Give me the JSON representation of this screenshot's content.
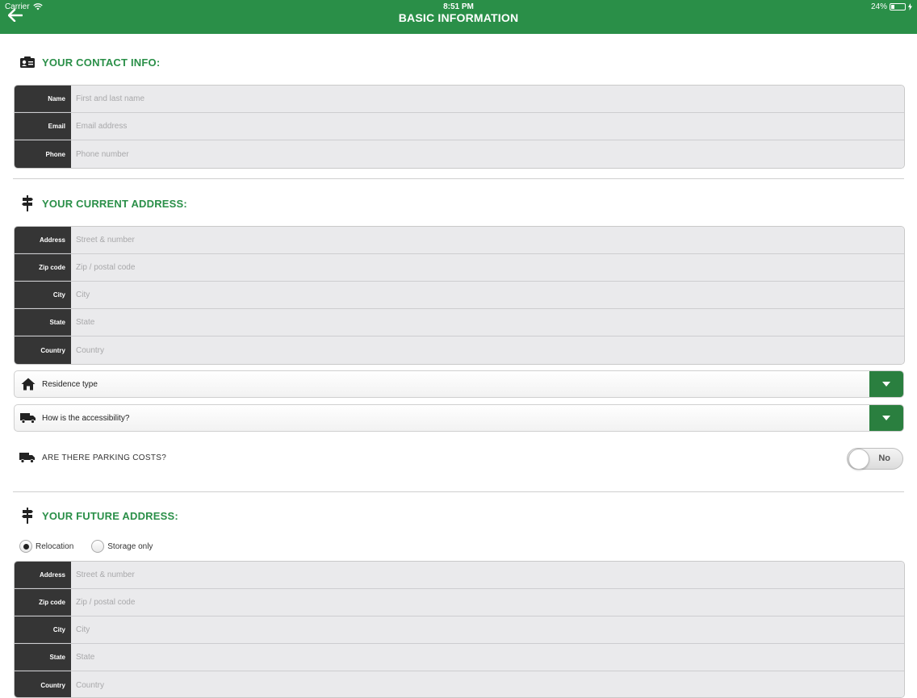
{
  "status_bar": {
    "carrier": "Carrier",
    "time": "8:51 PM",
    "battery": "24%"
  },
  "header": {
    "title": "BASIC INFORMATION",
    "accent_color": "#2a8f48"
  },
  "contact": {
    "title": "YOUR CONTACT INFO:",
    "icon": "contact-card-icon",
    "fields": [
      {
        "label": "Name",
        "placeholder": "First and last name"
      },
      {
        "label": "Email",
        "placeholder": "Email address"
      },
      {
        "label": "Phone",
        "placeholder": "Phone number"
      }
    ]
  },
  "current_address": {
    "title": "YOUR CURRENT ADDRESS:",
    "icon": "signpost-icon",
    "fields": [
      {
        "label": "Address",
        "placeholder": "Street & number"
      },
      {
        "label": "Zip code",
        "placeholder": "Zip / postal code"
      },
      {
        "label": "City",
        "placeholder": "City"
      },
      {
        "label": "State",
        "placeholder": "State"
      },
      {
        "label": "Country",
        "placeholder": "Country"
      }
    ],
    "residence_type": {
      "label": "Residence type",
      "icon": "house-icon"
    },
    "accessibility": {
      "label": "How is the accessibility?",
      "icon": "truck-icon"
    },
    "parking": {
      "label": "ARE THERE PARKING COSTS?",
      "icon": "truck-icon",
      "value": "No"
    }
  },
  "future_address": {
    "title": "YOUR FUTURE ADDRESS:",
    "icon": "signpost-icon",
    "options": [
      {
        "label": "Relocation",
        "checked": true
      },
      {
        "label": "Storage only",
        "checked": false
      }
    ],
    "fields": [
      {
        "label": "Address",
        "placeholder": "Street & number"
      },
      {
        "label": "Zip code",
        "placeholder": "Zip / postal code"
      },
      {
        "label": "City",
        "placeholder": "City"
      },
      {
        "label": "State",
        "placeholder": "State"
      },
      {
        "label": "Country",
        "placeholder": "Country"
      }
    ]
  }
}
